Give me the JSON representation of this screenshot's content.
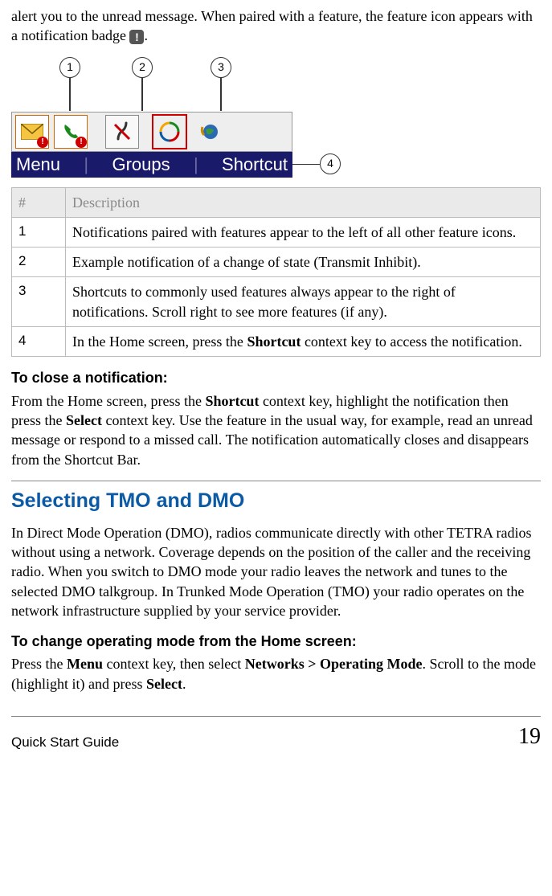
{
  "intro": {
    "line1": "alert you to the unread message. When paired with a feature, the feature icon appears with a notification badge ",
    "badge_symbol": "!",
    "period": "."
  },
  "diagram": {
    "callouts": [
      "1",
      "2",
      "3",
      "4"
    ],
    "softkeys": {
      "left": "Menu",
      "center": "Groups",
      "right": "Shortcut"
    }
  },
  "table": {
    "header_num": "#",
    "header_desc": "Description",
    "rows": [
      {
        "n": "1",
        "d": "Notifications paired with features appear to the left of all other feature icons."
      },
      {
        "n": "2",
        "d": "Example notification of a change of state (Transmit Inhibit)."
      },
      {
        "n": "3",
        "d": "Shortcuts to commonly used features always appear to the right of notifications. Scroll right to see more features (if any)."
      },
      {
        "n": "4",
        "d_pre": "In the Home screen, press the ",
        "d_bold": "Shortcut",
        "d_post": " context key to access the notification."
      }
    ]
  },
  "close_notif": {
    "heading": "To close a notification:",
    "p_1": "From the Home screen, press the ",
    "p_b1": "Shortcut",
    "p_2": " context key, highlight the notification then press the ",
    "p_b2": "Select",
    "p_3": " context key. Use the feature in the usual way, for example, read an unread message or respond to a missed call. The notification automatically closes and disappears from the Shortcut Bar."
  },
  "section": {
    "title": "Selecting TMO and DMO",
    "para": "In Direct Mode Operation (DMO), radios communicate directly with other TETRA radios without using a network. Coverage depends on the position of the caller and the receiving radio. When you switch to DMO mode your radio leaves the network and tunes to the selected DMO talkgroup. In Trunked Mode Operation (TMO) your radio operates on the network infrastructure supplied by your service provider."
  },
  "change_mode": {
    "heading": "To change operating mode from the Home screen:",
    "p_1": "Press the ",
    "p_b1": "Menu",
    "p_2": " context key, then select ",
    "p_b2": "Networks > Operating Mode",
    "p_3": ". Scroll to the mode (highlight it) and press ",
    "p_b3": "Select",
    "p_4": "."
  },
  "footer": {
    "left": "Quick Start Guide",
    "right": "19"
  }
}
